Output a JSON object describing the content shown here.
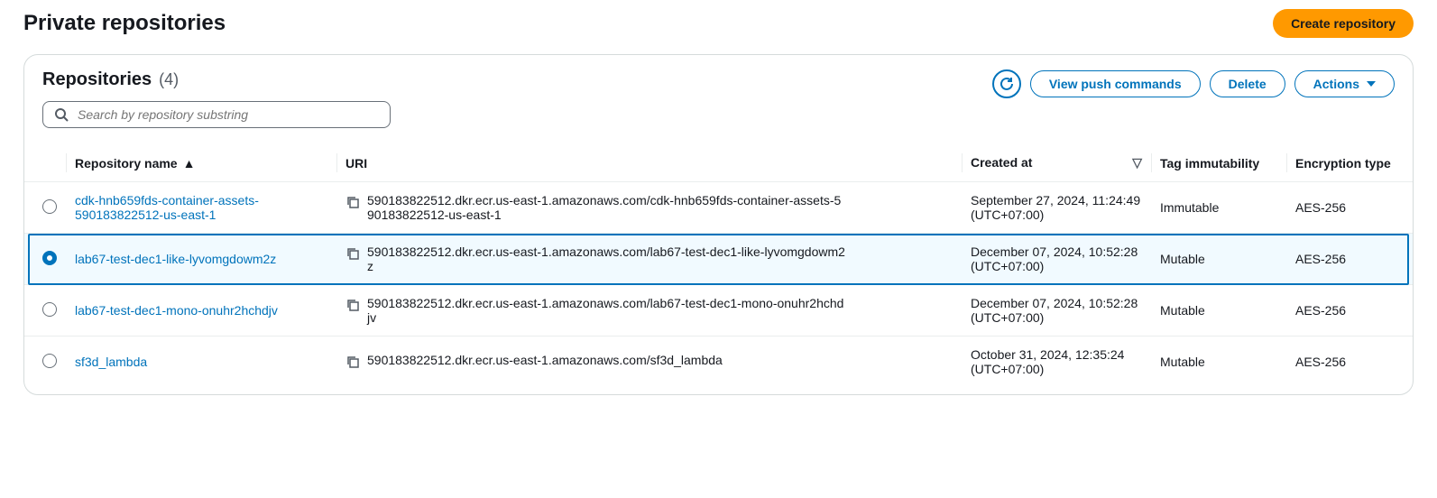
{
  "page": {
    "title": "Private repositories",
    "create_button": "Create repository"
  },
  "panel": {
    "title": "Repositories",
    "count": "(4)",
    "actions": {
      "view_push": "View push commands",
      "delete": "Delete",
      "actions": "Actions"
    },
    "search": {
      "placeholder": "Search by repository substring"
    }
  },
  "columns": {
    "name": "Repository name",
    "uri": "URI",
    "created": "Created at",
    "tag": "Tag immutability",
    "enc": "Encryption type"
  },
  "rows": [
    {
      "selected": false,
      "name": "cdk-hnb659fds-container-assets-590183822512-us-east-1",
      "uri": "590183822512.dkr.ecr.us-east-1.amazonaws.com/cdk-hnb659fds-container-assets-590183822512-us-east-1",
      "created": "September 27, 2024, 11:24:49 (UTC+07:00)",
      "tag": "Immutable",
      "enc": "AES-256"
    },
    {
      "selected": true,
      "name": "lab67-test-dec1-like-lyvomgdowm2z",
      "uri": "590183822512.dkr.ecr.us-east-1.amazonaws.com/lab67-test-dec1-like-lyvomgdowm2z",
      "created": "December 07, 2024, 10:52:28 (UTC+07:00)",
      "tag": "Mutable",
      "enc": "AES-256"
    },
    {
      "selected": false,
      "name": "lab67-test-dec1-mono-onuhr2hchdjv",
      "uri": "590183822512.dkr.ecr.us-east-1.amazonaws.com/lab67-test-dec1-mono-onuhr2hchdjv",
      "created": "December 07, 2024, 10:52:28 (UTC+07:00)",
      "tag": "Mutable",
      "enc": "AES-256"
    },
    {
      "selected": false,
      "name": "sf3d_lambda",
      "uri": "590183822512.dkr.ecr.us-east-1.amazonaws.com/sf3d_lambda",
      "created": "October 31, 2024, 12:35:24 (UTC+07:00)",
      "tag": "Mutable",
      "enc": "AES-256"
    }
  ]
}
